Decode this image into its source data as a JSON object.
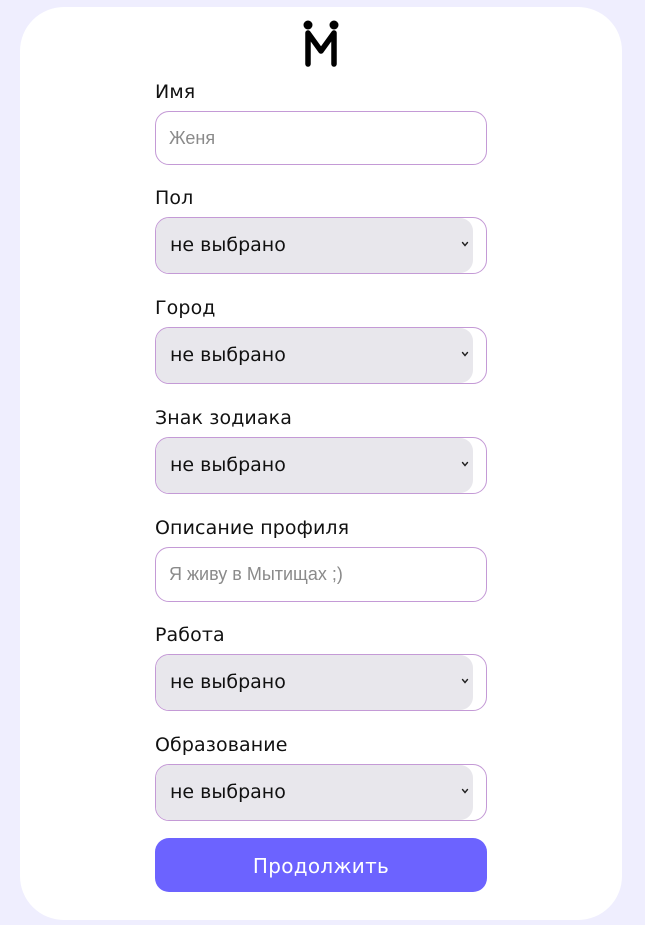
{
  "form": {
    "name": {
      "label": "Имя",
      "placeholder": "Женя"
    },
    "gender": {
      "label": "Пол",
      "value": "не выбрано"
    },
    "city": {
      "label": "Город",
      "value": "не выбрано"
    },
    "zodiac": {
      "label": "Знак зодиака",
      "value": "не выбрано"
    },
    "description": {
      "label": "Описание профиля",
      "placeholder": "Я живу в Мытищах ;)"
    },
    "work": {
      "label": "Работа",
      "value": "не выбрано"
    },
    "education": {
      "label": "Образование",
      "value": "не выбрано"
    },
    "submit_label": "Продолжить"
  },
  "colors": {
    "background": "#efeefe",
    "card": "#ffffff",
    "input_border": "#c49ad6",
    "select_fill": "#e8e7ec",
    "button": "#6c63ff"
  },
  "icons": {
    "logo": "logo-icon",
    "dropdown": "chevron-down-icon"
  }
}
